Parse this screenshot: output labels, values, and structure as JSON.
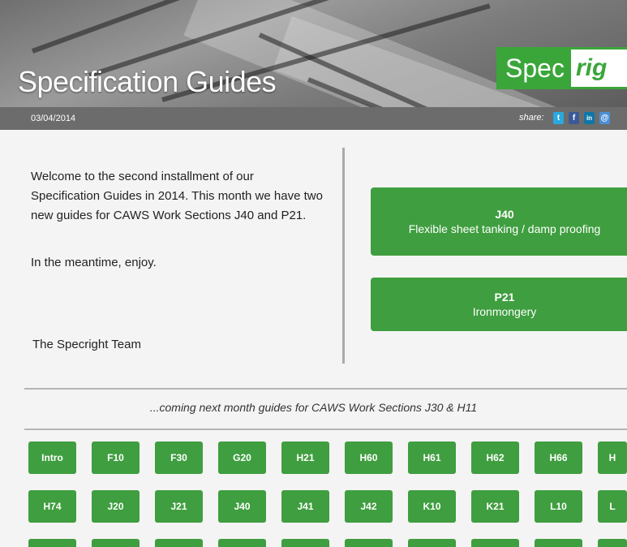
{
  "header": {
    "title": "Specification Guides",
    "logo": {
      "spec": "Spec",
      "right": "rig"
    }
  },
  "bar": {
    "date": "03/04/2014",
    "share_label": "share:",
    "social": [
      {
        "name": "twitter-icon",
        "glyph": "t",
        "color": "#2aa9e0"
      },
      {
        "name": "facebook-icon",
        "glyph": "f",
        "color": "#3b5998"
      },
      {
        "name": "linkedin-icon",
        "glyph": "in",
        "color": "#0e76a8"
      },
      {
        "name": "email-icon",
        "glyph": "@",
        "color": "#4a90d9"
      }
    ]
  },
  "intro": {
    "paragraph1": "Welcome to the second installment of our Specification Guides in 2014. This month we have two new guides for CAWS Work Sections J40 and P21.",
    "paragraph2": "In the meantime, enjoy.",
    "signoff": "The Specright Team"
  },
  "guides": [
    {
      "code": "J40",
      "title": "Flexible sheet tanking / damp proofing"
    },
    {
      "code": "P21",
      "title": "Ironmongery"
    }
  ],
  "coming_next": "...coming next month guides for CAWS Work Sections J30 & H11",
  "tiles": {
    "row1": [
      "Intro",
      "F10",
      "F30",
      "G20",
      "H21",
      "H60",
      "H61",
      "H62",
      "H66",
      "H"
    ],
    "row2": [
      "H74",
      "J20",
      "J21",
      "J40",
      "J41",
      "J42",
      "K10",
      "K21",
      "L10",
      "L"
    ]
  },
  "colors": {
    "accent": "#3f9e3f",
    "bar": "#6c6c6c"
  }
}
